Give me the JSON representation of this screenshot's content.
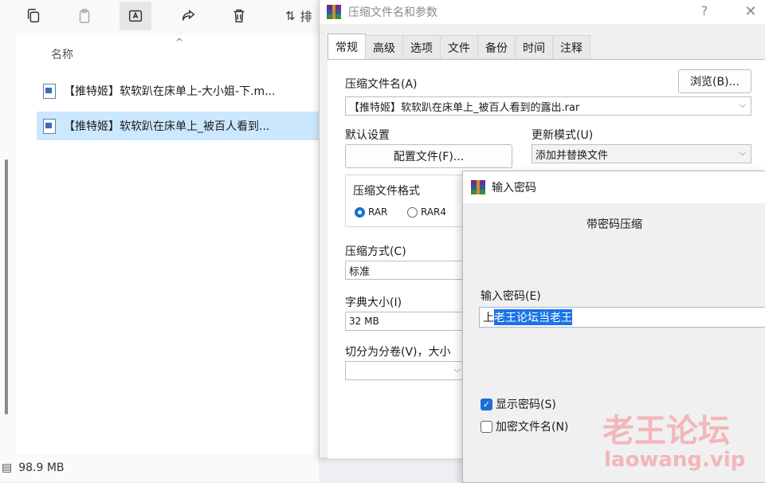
{
  "explorer": {
    "toolbar": {
      "icons": [
        "copy-icon",
        "paste-icon",
        "rename-icon",
        "share-icon",
        "delete-icon",
        "sort-icon"
      ],
      "sort_label": "排"
    },
    "column_name": "名称",
    "files": [
      {
        "name": "【推特姬】软软趴在床单上-大小姐-下.m...",
        "selected": false
      },
      {
        "name": "【推特姬】软软趴在床单上_被百人看到...",
        "selected": true
      }
    ],
    "status_size": "98.9 MB"
  },
  "archive_dialog": {
    "title": "压缩文件名和参数",
    "help": "?",
    "close": "✕",
    "tabs": [
      "常规",
      "高级",
      "选项",
      "文件",
      "备份",
      "时间",
      "注释"
    ],
    "active_tab": "常规",
    "archive_name_label": "压缩文件名(A)",
    "browse_button": "浏览(B)...",
    "archive_name_value": "【推特姬】软软趴在床单上_被百人看到的露出.rar",
    "default_settings_label": "默认设置",
    "profiles_button": "配置文件(F)...",
    "update_mode_label": "更新模式(U)",
    "update_mode_value": "添加并替换文件",
    "format_label": "压缩文件格式",
    "format_options": [
      "RAR",
      "RAR4"
    ],
    "format_selected": "RAR",
    "method_label": "压缩方式(C)",
    "method_value": "标准",
    "dict_label": "字典大小(I)",
    "dict_value": "32 MB",
    "split_label": "切分为分卷(V)，大小",
    "split_value": ""
  },
  "password_dialog": {
    "title": "输入密码",
    "heading": "带密码压缩",
    "field_label": "输入密码(E)",
    "password_prefix": "上",
    "password_selected": "老王论坛当老王",
    "show_password_label": "显示密码(S)",
    "show_password_checked": true,
    "encrypt_names_label": "加密文件名(N)",
    "encrypt_names_checked": false
  },
  "watermark": {
    "line1": "老王论坛",
    "line2": "laowang.vip"
  }
}
